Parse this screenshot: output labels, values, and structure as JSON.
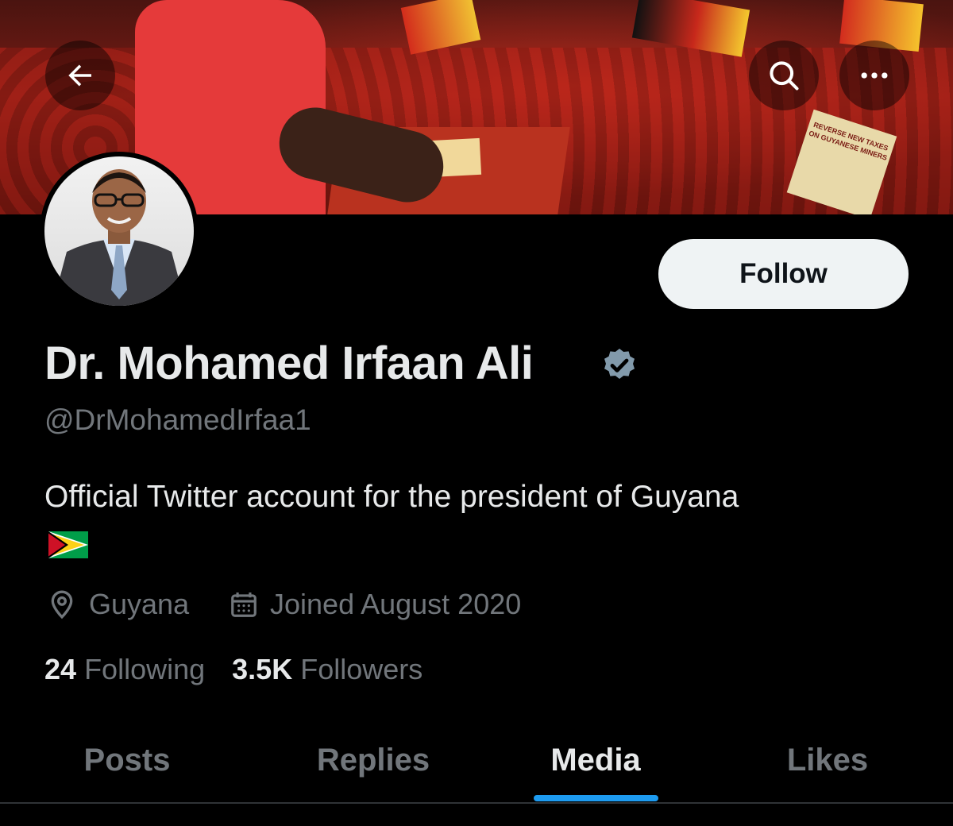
{
  "header": {
    "back_icon": "arrow-left-icon",
    "search_icon": "search-icon",
    "more_icon": "more-horizontal-icon",
    "banner_sign_text": "REVERSE NEW TAXES ON GUYANESE MINERS"
  },
  "profile": {
    "name": "Dr. Mohamed Irfaan Ali",
    "verified_icon": "verified-badge-icon",
    "handle": "@DrMohamedIrfaa1",
    "bio": "Official Twitter account for the president of Guyana",
    "bio_emoji": "guyana-flag-emoji",
    "follow_label": "Follow",
    "location_icon": "location-pin-icon",
    "location": "Guyana",
    "joined_icon": "calendar-icon",
    "joined": "Joined August 2020",
    "following_count": "24",
    "following_label": "Following",
    "followers_count": "3.5K",
    "followers_label": "Followers"
  },
  "tabs": [
    {
      "label": "Posts",
      "active": false
    },
    {
      "label": "Replies",
      "active": false
    },
    {
      "label": "Media",
      "active": true
    },
    {
      "label": "Likes",
      "active": false
    }
  ],
  "colors": {
    "background": "#000000",
    "text_primary": "#e7e9ea",
    "text_secondary": "#71767b",
    "accent": "#1d9bf0",
    "follow_bg": "#eff3f4",
    "verified": "#829aab"
  }
}
